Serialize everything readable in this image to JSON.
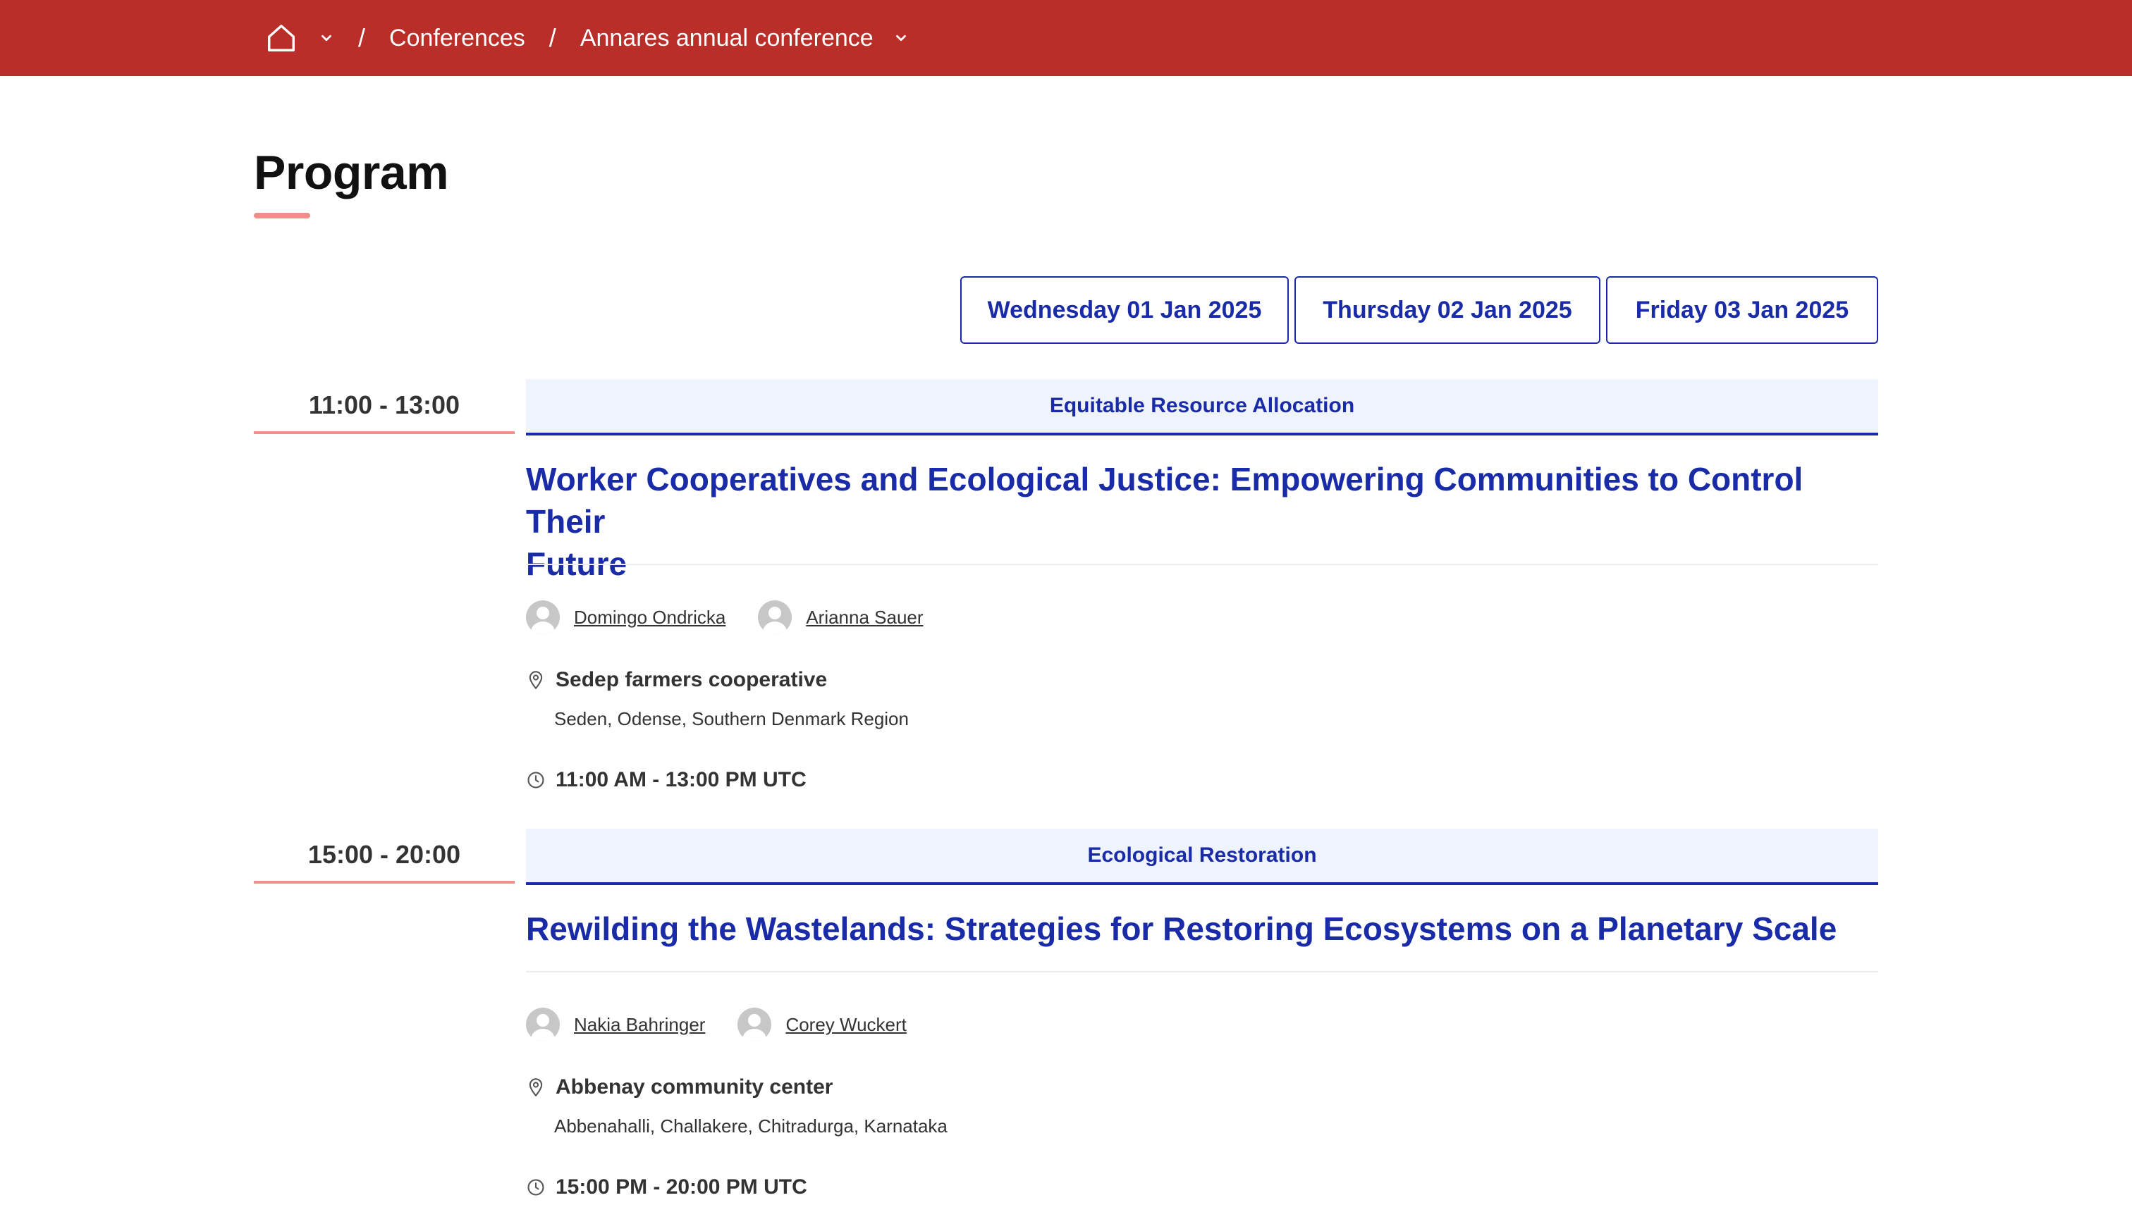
{
  "breadcrumb": {
    "items": [
      "Conferences",
      "Annares annual conference"
    ],
    "separator": "/"
  },
  "page": {
    "title": "Program"
  },
  "days": [
    {
      "label": "Wednesday 01 Jan 2025"
    },
    {
      "label": "Thursday 02 Jan 2025"
    },
    {
      "label": "Friday 03 Jan 2025"
    }
  ],
  "sessions": [
    {
      "time_range": "11:00 - 13:00",
      "track": "Equitable Resource Allocation",
      "title_line1": "Worker Cooperatives and Ecological Justice: Empowering Communities to Control Their",
      "title_line2": "Future",
      "speakers": [
        "Domingo Ondricka",
        "Arianna Sauer"
      ],
      "venue": "Sedep farmers cooperative",
      "address": "Seden, Odense, Southern Denmark Region",
      "time_detail": "11:00 AM - 13:00 PM UTC"
    },
    {
      "time_range": "15:00 - 20:00",
      "track": "Ecological Restoration",
      "title_line1": "Rewilding the Wastelands: Strategies for Restoring Ecosystems on a Planetary Scale",
      "speakers": [
        "Nakia Bahringer",
        "Corey Wuckert"
      ],
      "venue": "Abbenay community center",
      "address": "Abbenahalli, Challakere, Chitradurga, Karnataka",
      "time_detail": "15:00 PM - 20:00 PM UTC"
    }
  ],
  "colors": {
    "header": "#b92e29",
    "accent": "#1a2ba8",
    "track_bg": "#eef3fc",
    "underline": "#ee8f89"
  }
}
